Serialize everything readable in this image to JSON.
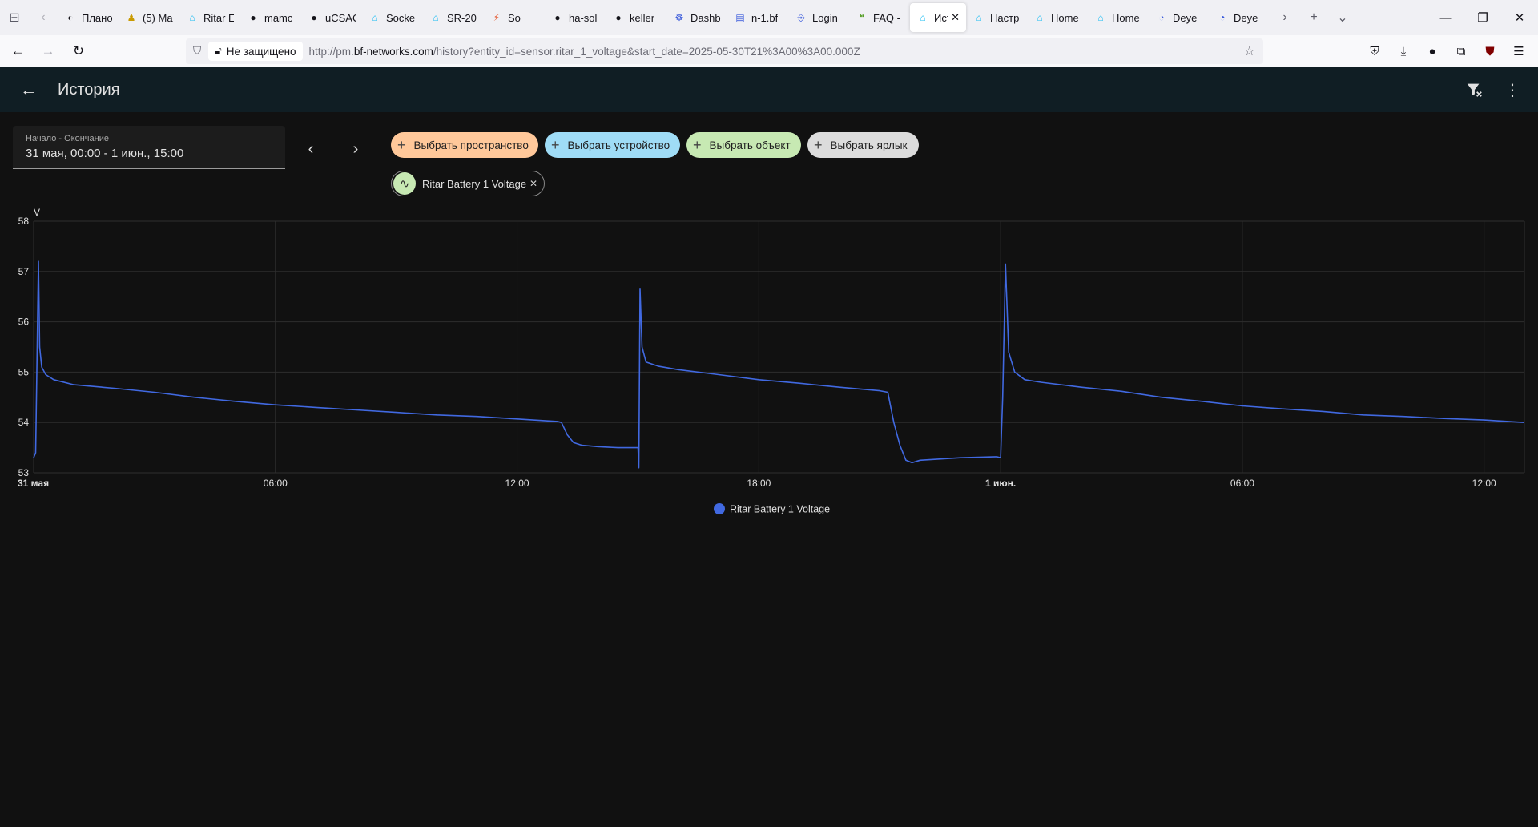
{
  "browser": {
    "tabs": [
      {
        "label": "Плано",
        "icon": "ha-icon"
      },
      {
        "label": "(5) Ma",
        "icon": "person-icon"
      },
      {
        "label": "Ritar E",
        "icon": "home-assistant-icon"
      },
      {
        "label": "mamc",
        "icon": "github-icon"
      },
      {
        "label": "uCSAC",
        "icon": "github-icon"
      },
      {
        "label": "Socke",
        "icon": "home-assistant-icon"
      },
      {
        "label": "SR-20",
        "icon": "home-assistant-icon"
      },
      {
        "label": "So",
        "icon": "lightning-icon"
      },
      {
        "label": "ha-sol",
        "icon": "github-icon"
      },
      {
        "label": "keller",
        "icon": "github-icon"
      },
      {
        "label": "Dashb",
        "icon": "dashboard-icon"
      },
      {
        "label": "n-1.bf",
        "icon": "page-icon"
      },
      {
        "label": "Login",
        "icon": "login-icon"
      },
      {
        "label": "FAQ -",
        "icon": "faq-icon"
      },
      {
        "label": "Ист",
        "icon": "home-assistant-icon",
        "active": true
      },
      {
        "label": "Настр",
        "icon": "home-assistant-icon"
      },
      {
        "label": "Home",
        "icon": "home-assistant-icon"
      },
      {
        "label": "Home",
        "icon": "home-assistant-icon"
      },
      {
        "label": "Deye",
        "icon": "deye-icon"
      },
      {
        "label": "Deye",
        "icon": "deye-icon"
      }
    ],
    "insecure_label": "Не защищено",
    "url_prefix": "http://pm.",
    "url_domain": "bf-networks.com",
    "url_path": "/history?entity_id=sensor.ritar_1_voltage&start_date=2025-05-30T21%3A00%3A00.000Z"
  },
  "header": {
    "title": "История"
  },
  "filters": {
    "date_label": "Начало - Окончание",
    "date_value": "31 мая, 00:00 - 1 июн., 15:00",
    "chips": {
      "area": "Выбрать пространство",
      "device": "Выбрать устройство",
      "entity": "Выбрать объект",
      "label": "Выбрать ярлык"
    },
    "selected_entity": "Ritar Battery 1 Voltage"
  },
  "colors": {
    "series": "#4169e1",
    "area_chip": "#ffc89a",
    "device_chip": "#9fdcf6",
    "entity_chip": "#c7e9b3",
    "label_chip": "#dcdcdc"
  },
  "chart_data": {
    "type": "line",
    "ylabel": "V",
    "ylim": [
      53,
      58
    ],
    "yticks": [
      "53",
      "54",
      "55",
      "56",
      "57",
      "58"
    ],
    "xlim_hours": [
      0,
      37
    ],
    "xticks": [
      {
        "hour": 0,
        "label": "31 мая",
        "bold": true
      },
      {
        "hour": 6,
        "label": "06:00",
        "bold": false
      },
      {
        "hour": 12,
        "label": "12:00",
        "bold": false
      },
      {
        "hour": 18,
        "label": "18:00",
        "bold": false
      },
      {
        "hour": 24,
        "label": "1 июн.",
        "bold": true
      },
      {
        "hour": 30,
        "label": "06:00",
        "bold": false
      },
      {
        "hour": 36,
        "label": "12:00",
        "bold": false
      }
    ],
    "grid": true,
    "legend_position": "bottom-center",
    "series": [
      {
        "name": "Ritar Battery 1 Voltage",
        "points": [
          [
            0.0,
            53.3
          ],
          [
            0.05,
            53.4
          ],
          [
            0.12,
            57.2
          ],
          [
            0.15,
            55.5
          ],
          [
            0.2,
            55.1
          ],
          [
            0.3,
            54.95
          ],
          [
            0.5,
            54.85
          ],
          [
            1.0,
            54.75
          ],
          [
            2.0,
            54.68
          ],
          [
            3.0,
            54.6
          ],
          [
            4.0,
            54.5
          ],
          [
            5.0,
            54.42
          ],
          [
            6.0,
            54.35
          ],
          [
            7.0,
            54.3
          ],
          [
            8.0,
            54.25
          ],
          [
            9.0,
            54.2
          ],
          [
            10.0,
            54.15
          ],
          [
            11.0,
            54.12
          ],
          [
            12.0,
            54.07
          ],
          [
            13.0,
            54.02
          ],
          [
            13.1,
            54.0
          ],
          [
            13.25,
            53.75
          ],
          [
            13.4,
            53.6
          ],
          [
            13.6,
            53.55
          ],
          [
            14.0,
            53.52
          ],
          [
            14.5,
            53.5
          ],
          [
            15.0,
            53.5
          ],
          [
            15.02,
            53.1
          ],
          [
            15.05,
            56.65
          ],
          [
            15.1,
            55.5
          ],
          [
            15.2,
            55.2
          ],
          [
            15.5,
            55.12
          ],
          [
            16.0,
            55.05
          ],
          [
            17.0,
            54.95
          ],
          [
            18.0,
            54.85
          ],
          [
            19.0,
            54.78
          ],
          [
            20.0,
            54.7
          ],
          [
            21.0,
            54.63
          ],
          [
            21.2,
            54.6
          ],
          [
            21.35,
            54.0
          ],
          [
            21.5,
            53.55
          ],
          [
            21.65,
            53.25
          ],
          [
            21.8,
            53.2
          ],
          [
            22.0,
            53.25
          ],
          [
            23.0,
            53.3
          ],
          [
            23.9,
            53.32
          ],
          [
            24.0,
            53.3
          ],
          [
            24.05,
            54.5
          ],
          [
            24.12,
            57.15
          ],
          [
            24.2,
            55.4
          ],
          [
            24.35,
            55.0
          ],
          [
            24.6,
            54.85
          ],
          [
            25.0,
            54.8
          ],
          [
            26.0,
            54.7
          ],
          [
            27.0,
            54.62
          ],
          [
            28.0,
            54.5
          ],
          [
            29.0,
            54.42
          ],
          [
            30.0,
            54.33
          ],
          [
            31.0,
            54.27
          ],
          [
            32.0,
            54.22
          ],
          [
            33.0,
            54.15
          ],
          [
            34.0,
            54.12
          ],
          [
            35.0,
            54.08
          ],
          [
            36.0,
            54.05
          ],
          [
            37.0,
            54.0
          ]
        ]
      }
    ]
  }
}
